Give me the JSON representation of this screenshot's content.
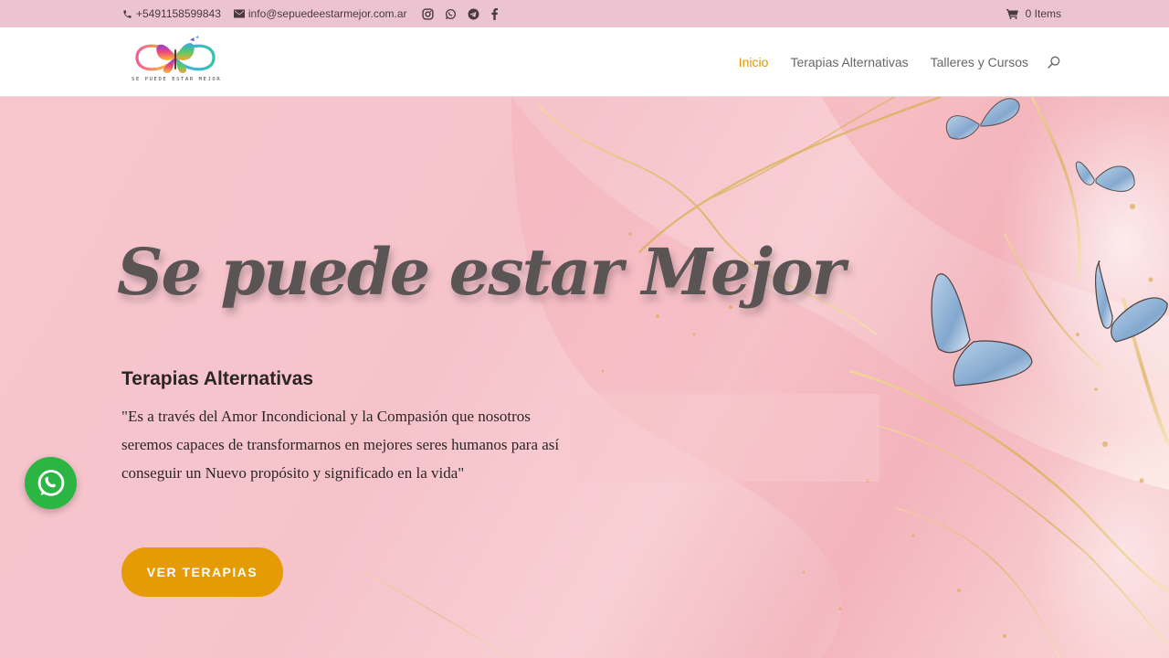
{
  "topbar": {
    "phone": "+5491158599843",
    "email": "info@sepuedeestarmejor.com.ar",
    "socials": [
      "instagram-icon",
      "whatsapp-icon",
      "telegram-icon",
      "facebook-icon"
    ],
    "cart": "0 Items"
  },
  "header": {
    "logo_text": "SE PUEDE ESTAR MEJOR",
    "nav": [
      {
        "label": "Inicio",
        "active": true
      },
      {
        "label": "Terapias Alternativas",
        "active": false
      },
      {
        "label": "Talleres y Cursos",
        "active": false
      }
    ]
  },
  "hero": {
    "title": "Se puede estar Mejor",
    "subtitle": "Terapias Alternativas",
    "quote": "\"Es a través del Amor Incondicional y la Compasión que nosotros seremos capaces de transformarnos en mejores seres humanos para así conseguir un Nuevo propósito y significado en la vida\"",
    "cta": "VER TERAPIAS"
  },
  "colors": {
    "accent": "#e09900",
    "button": "#e49b06",
    "topbar": "#ecc3d0",
    "whatsapp": "#2bb543"
  }
}
